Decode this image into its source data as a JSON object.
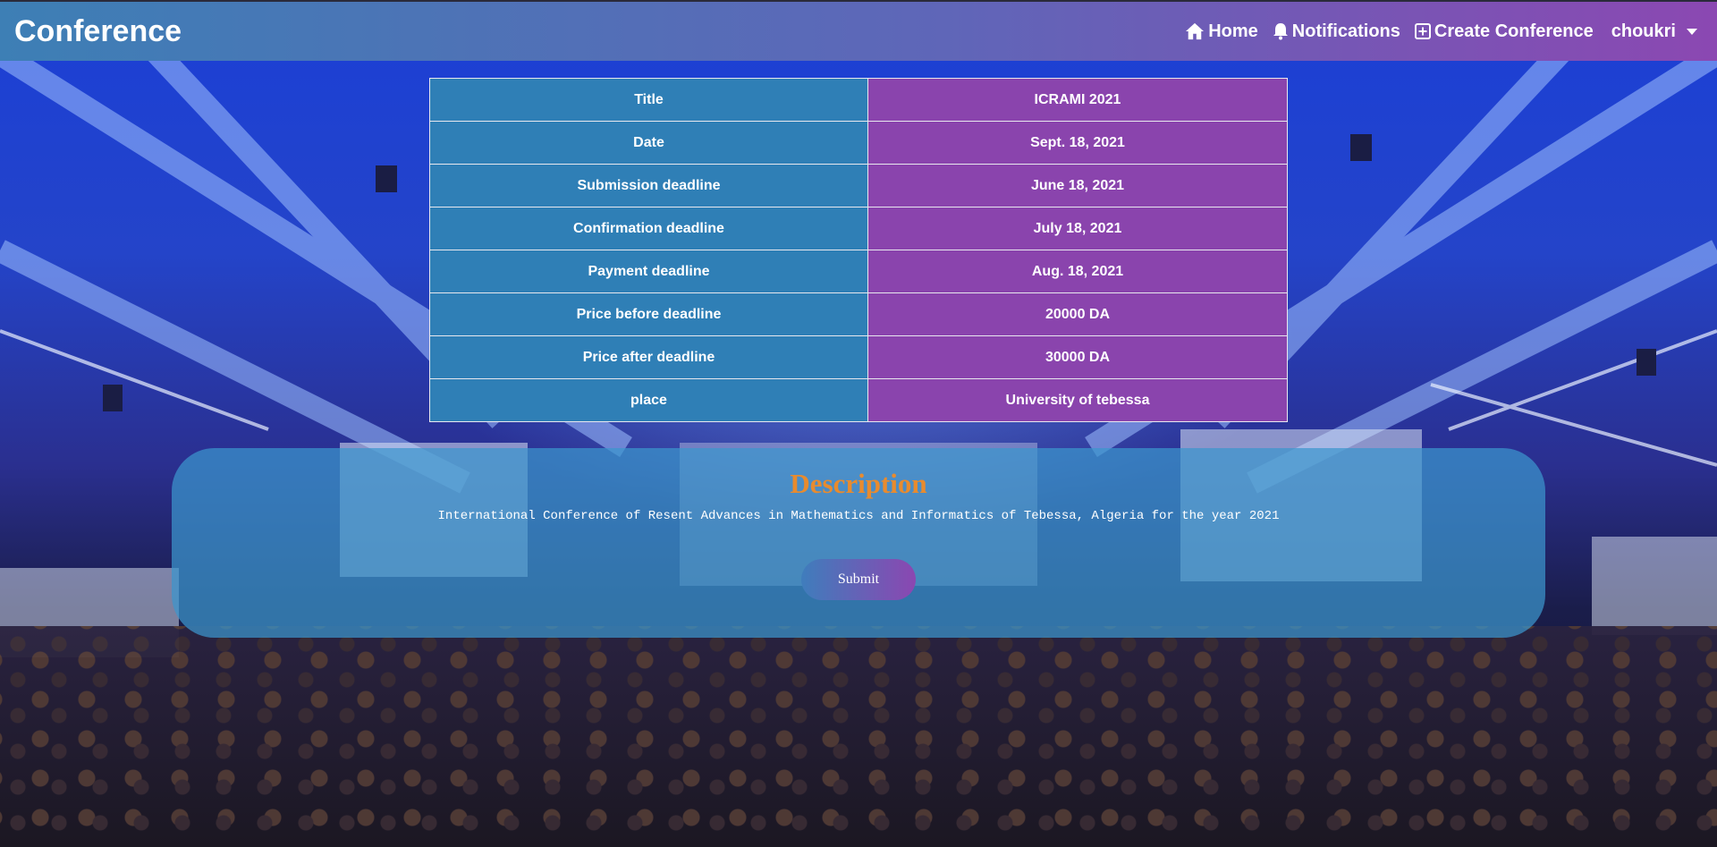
{
  "navbar": {
    "brand": "Conference",
    "links": [
      {
        "label": "Home",
        "icon": "home-icon"
      },
      {
        "label": "Notifications",
        "icon": "bell-icon"
      },
      {
        "label": "Create Conference",
        "icon": "plus-square-icon"
      }
    ],
    "user": {
      "label": "choukri",
      "icon": "chevron-down-icon"
    }
  },
  "conference": {
    "rows": [
      {
        "label": "Title",
        "value": "ICRAMI 2021"
      },
      {
        "label": "Date",
        "value": "Sept. 18, 2021"
      },
      {
        "label": "Submission deadline",
        "value": "June 18, 2021"
      },
      {
        "label": "Confirmation deadline",
        "value": "July 18, 2021"
      },
      {
        "label": "Payment deadline",
        "value": "Aug. 18, 2021"
      },
      {
        "label": "Price before deadline",
        "value": "20000 DA"
      },
      {
        "label": "Price after deadline",
        "value": "30000 DA"
      },
      {
        "label": "place",
        "value": "University of tebessa"
      }
    ]
  },
  "description": {
    "heading": "Description",
    "text": "International Conference of Resent Advances in Mathematics and Informatics of Tebessa, Algeria for the year 2021",
    "submit_label": "Submit"
  },
  "colors": {
    "table_key_bg": "#2f7fb6",
    "table_value_bg": "#8a44ad",
    "heading_orange": "#e88b2e",
    "panel_bg": "rgba(60,150,205,0.72)"
  }
}
